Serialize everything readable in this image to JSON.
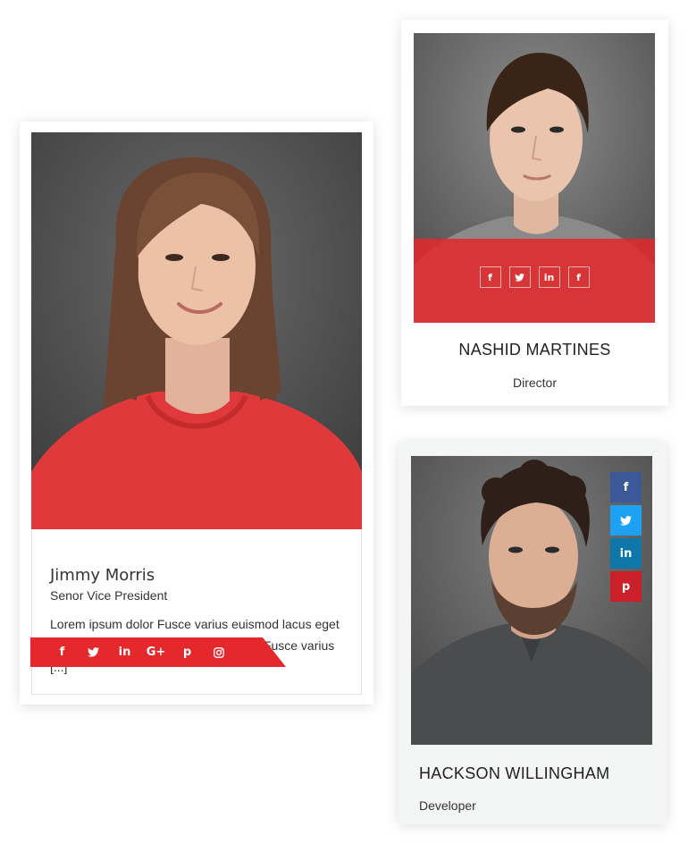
{
  "cards": [
    {
      "name": "Jimmy Morris",
      "role": "Senor Vice President",
      "bio": "Lorem ipsum dolor Fusce varius euismod lacus eget feugiat rorem ipsum dolor consectetur Fusce varius [...]",
      "social_icons": [
        {
          "icon": "facebook-icon",
          "glyph": "f"
        },
        {
          "icon": "twitter-icon",
          "glyph": "🐦"
        },
        {
          "icon": "linkedin-icon",
          "glyph": "in"
        },
        {
          "icon": "google-plus-icon",
          "glyph": "G+"
        },
        {
          "icon": "pinterest-icon",
          "glyph": "p"
        },
        {
          "icon": "instagram-icon",
          "glyph": "◎"
        }
      ],
      "accent": "#e4282b"
    },
    {
      "name": "NASHID MARTINES",
      "role": "Director",
      "social_icons": [
        {
          "icon": "facebook-icon",
          "glyph": "f"
        },
        {
          "icon": "twitter-icon",
          "glyph": "🐦"
        },
        {
          "icon": "linkedin-icon",
          "glyph": "in"
        },
        {
          "icon": "facebook-icon",
          "glyph": "f"
        }
      ],
      "accent": "#e4282b"
    },
    {
      "name": "HACKSON WILLINGHAM",
      "role": "Developer",
      "social_icons": [
        {
          "icon": "facebook-icon",
          "glyph": "f",
          "color": "#3b5998"
        },
        {
          "icon": "twitter-icon",
          "glyph": "🐦",
          "color": "#1da1f2"
        },
        {
          "icon": "linkedin-icon",
          "glyph": "in",
          "color": "#0e76a8"
        },
        {
          "icon": "pinterest-icon",
          "glyph": "p",
          "color": "#cb2027"
        }
      ]
    }
  ]
}
